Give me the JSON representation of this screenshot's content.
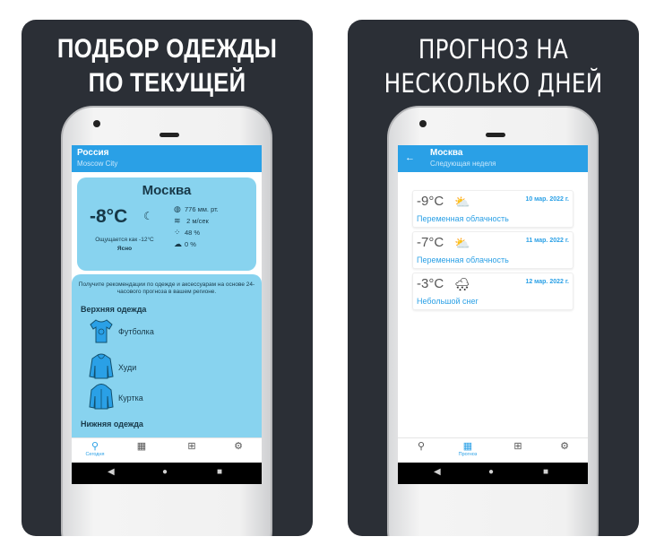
{
  "left_panel": {
    "title_line1": "ПОДБОР ОДЕЖДЫ",
    "title_line2": "ПО ТЕКУЩЕЙ ПОГОДЕ",
    "appbar": {
      "title": "Россия",
      "subtitle": "Moscow City"
    },
    "weather": {
      "city": "Москва",
      "temperature": "-8°C",
      "feels_like": "Ощущается как -12°C",
      "condition": "Ясно",
      "pressure": "776 мм. рт.",
      "wind": "2 м/сек",
      "humidity": "48 %",
      "precipitation": "0 %"
    },
    "recommendation_text": "Получите рекомендации по одежде и аксессуарам на основе 24-часового прогноза в вашем регионе.",
    "sections": {
      "outer": "Верхняя одежда",
      "under": "Нижняя одежда"
    },
    "clothes": [
      "Футболка",
      "Худи",
      "Куртка"
    ],
    "nav_active_label": "Сегодня"
  },
  "right_panel": {
    "title_line1": "ПРОГНОЗ НА",
    "title_line2": "НЕСКОЛЬКО ДНЕЙ",
    "appbar": {
      "title": "Москва",
      "subtitle": "Следующая неделя"
    },
    "days": [
      {
        "temp": "-9°C",
        "date": "10 мар. 2022 г.",
        "desc": "Переменная облачность",
        "icon": "partly-cloudy-icon"
      },
      {
        "temp": "-7°C",
        "date": "11 мар. 2022 г.",
        "desc": "Переменная облачность",
        "icon": "partly-cloudy-icon"
      },
      {
        "temp": "-3°C",
        "date": "12 мар. 2022 г.",
        "desc": "Небольшой снег",
        "icon": "snow-cloud-icon"
      }
    ],
    "nav_active_label": "Прогноз"
  },
  "colors": {
    "panel_bg": "#2b2f36",
    "accent": "#2aa0e6",
    "card": "#88d3ef"
  }
}
